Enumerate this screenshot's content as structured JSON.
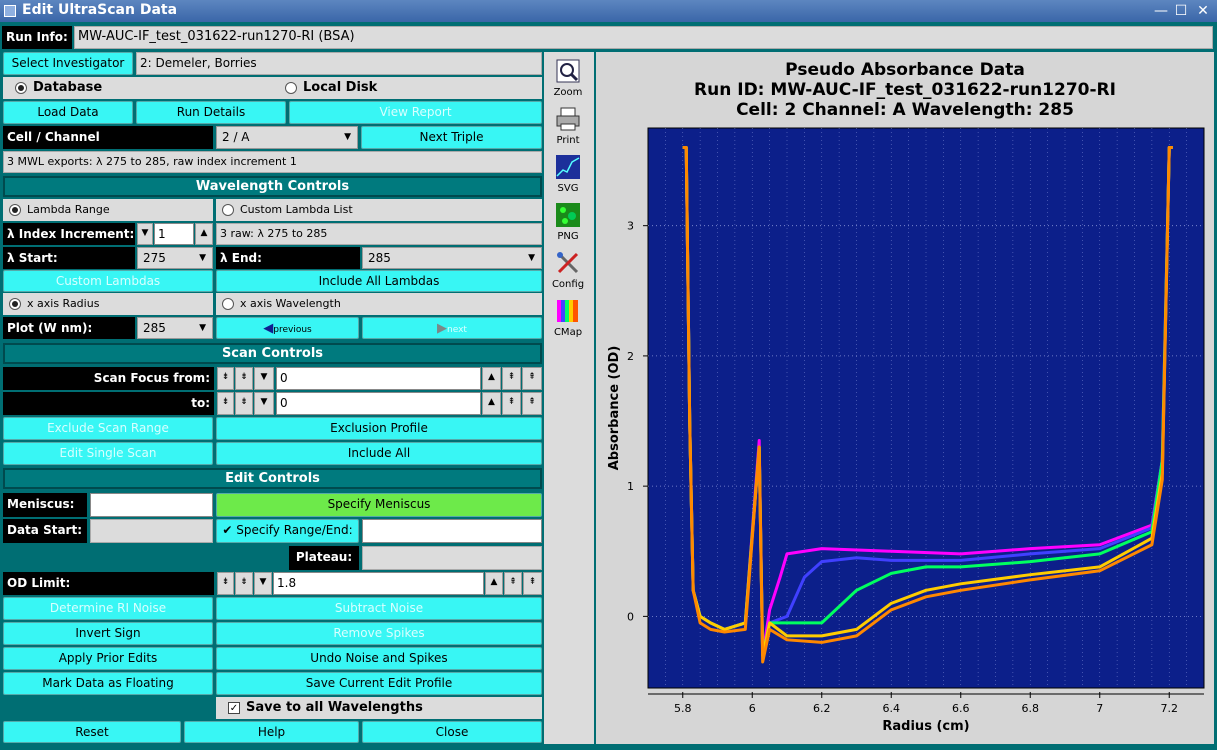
{
  "window": {
    "title": "Edit UltraScan Data",
    "controls": [
      "—",
      "☐",
      "✕"
    ]
  },
  "run_info": {
    "label": "Run Info:",
    "value": "MW-AUC-IF_test_031622-run1270-RI  (BSA)"
  },
  "investigator": {
    "button": "Select Investigator",
    "value": "2: Demeler, Borries"
  },
  "source": {
    "database": "Database",
    "local": "Local Disk"
  },
  "top_buttons": {
    "load": "Load Data",
    "details": "Run Details",
    "report": "View Report"
  },
  "cell_channel": {
    "label": "Cell / Channel",
    "value": "2 / A",
    "next": "Next Triple"
  },
  "mwl_info": "3 MWL exports: λ 275 to 285, raw index increment 1",
  "wavelength": {
    "header": "Wavelength Controls",
    "lambda_range": "Lambda Range",
    "custom_list": "Custom Lambda List",
    "index_label": "λ Index Increment:",
    "index_value": "1",
    "raw_info": "3 raw: λ 275 to 285",
    "start_label": "λ Start:",
    "start_value": "275",
    "end_label": "λ End:",
    "end_value": "285",
    "custom_lambdas": "Custom Lambdas",
    "include_all": "Include All Lambdas",
    "x_radius": "x axis Radius",
    "x_wavelength": "x axis Wavelength",
    "plot_label": "Plot (W nm):",
    "plot_value": "285",
    "previous": "previous",
    "next": "next"
  },
  "scan": {
    "header": "Scan Controls",
    "focus_from": "Scan Focus from:",
    "from_value": "0",
    "to": "to:",
    "to_value": "0",
    "exclude": "Exclude Scan Range",
    "profile": "Exclusion Profile",
    "edit_single": "Edit Single Scan",
    "include_all": "Include All"
  },
  "edit": {
    "header": "Edit Controls",
    "meniscus": "Meniscus:",
    "specify_meniscus": "Specify Meniscus",
    "data_start": "Data Start:",
    "specify_range": "Specify Range/End:",
    "plateau": "Plateau:",
    "od_limit": "OD Limit:",
    "od_value": "1.8",
    "ri_noise": "Determine RI Noise",
    "subtract": "Subtract Noise",
    "invert": "Invert Sign",
    "remove_spikes": "Remove Spikes",
    "apply_prior": "Apply Prior Edits",
    "undo": "Undo Noise and Spikes",
    "floating": "Mark Data as Floating",
    "save_profile": "Save Current Edit Profile",
    "save_all": "Save to all Wavelengths"
  },
  "bottom": {
    "reset": "Reset",
    "help": "Help",
    "close": "Close"
  },
  "tools": [
    "Zoom",
    "Print",
    "SVG",
    "PNG",
    "Config",
    "CMap"
  ],
  "chart_data": {
    "type": "line",
    "title": "Pseudo Absorbance Data",
    "subtitle1": "Run ID: MW-AUC-IF_test_031622-run1270-RI",
    "subtitle2": "Cell: 2  Channel: A  Wavelength: 285",
    "xlabel": "Radius (cm)",
    "ylabel": "Absorbance (OD)",
    "xlim": [
      5.7,
      7.3
    ],
    "ylim": [
      -0.55,
      3.75
    ],
    "x_ticks": [
      "5.8",
      "6",
      "6.2",
      "6.4",
      "6.6",
      "6.8",
      "7",
      "7.2"
    ],
    "x_tick_values": [
      5.8,
      6.0,
      6.2,
      6.4,
      6.6,
      6.8,
      7.0,
      7.2
    ],
    "y_ticks": [
      "0",
      "1",
      "2",
      "3"
    ],
    "y_tick_values": [
      0,
      1,
      2,
      3
    ],
    "background": "#0c1f8a",
    "series": [
      {
        "color": "#ff00ff",
        "x": [
          5.8,
          5.81,
          5.82,
          5.83,
          5.85,
          5.88,
          5.92,
          5.98,
          6.02,
          6.03,
          6.05,
          6.08,
          6.1,
          6.15,
          6.2,
          6.4,
          6.6,
          6.8,
          7.0,
          7.15,
          7.18,
          7.2,
          7.21
        ],
        "y": [
          3.6,
          3.6,
          1.5,
          0.2,
          0.0,
          -0.05,
          -0.1,
          -0.05,
          1.35,
          -0.3,
          0.05,
          0.3,
          0.48,
          0.5,
          0.52,
          0.5,
          0.48,
          0.52,
          0.55,
          0.7,
          1.2,
          3.6,
          3.6
        ]
      },
      {
        "color": "#4040ff",
        "x": [
          5.8,
          5.81,
          5.82,
          5.83,
          5.85,
          5.88,
          5.92,
          5.98,
          6.02,
          6.03,
          6.05,
          6.1,
          6.15,
          6.2,
          6.3,
          6.4,
          6.6,
          6.8,
          7.0,
          7.15,
          7.18,
          7.2,
          7.21
        ],
        "y": [
          3.6,
          3.6,
          1.5,
          0.2,
          0.0,
          -0.05,
          -0.1,
          -0.05,
          1.3,
          -0.3,
          -0.05,
          0.0,
          0.3,
          0.42,
          0.45,
          0.43,
          0.43,
          0.48,
          0.52,
          0.68,
          1.2,
          3.6,
          3.6
        ]
      },
      {
        "color": "#00ff60",
        "x": [
          5.8,
          5.81,
          5.82,
          5.83,
          5.85,
          5.88,
          5.92,
          5.98,
          6.02,
          6.03,
          6.05,
          6.1,
          6.2,
          6.3,
          6.4,
          6.5,
          6.6,
          6.8,
          7.0,
          7.15,
          7.18,
          7.2,
          7.21
        ],
        "y": [
          3.6,
          3.6,
          1.5,
          0.2,
          0.0,
          -0.05,
          -0.1,
          -0.05,
          1.3,
          -0.3,
          -0.05,
          -0.05,
          -0.05,
          0.2,
          0.33,
          0.38,
          0.38,
          0.42,
          0.48,
          0.65,
          1.2,
          3.6,
          3.6
        ]
      },
      {
        "color": "#ffcc00",
        "x": [
          5.8,
          5.81,
          5.82,
          5.83,
          5.85,
          5.88,
          5.92,
          5.98,
          6.02,
          6.03,
          6.05,
          6.1,
          6.2,
          6.3,
          6.4,
          6.5,
          6.6,
          6.8,
          7.0,
          7.15,
          7.18,
          7.2,
          7.21
        ],
        "y": [
          3.6,
          3.6,
          1.5,
          0.2,
          0.0,
          -0.05,
          -0.1,
          -0.05,
          1.3,
          -0.3,
          -0.05,
          -0.15,
          -0.15,
          -0.1,
          0.1,
          0.2,
          0.25,
          0.32,
          0.38,
          0.6,
          1.1,
          3.6,
          3.6
        ]
      },
      {
        "color": "#ff8800",
        "x": [
          5.8,
          5.81,
          5.82,
          5.83,
          5.85,
          5.88,
          5.92,
          5.98,
          6.02,
          6.03,
          6.05,
          6.1,
          6.2,
          6.3,
          6.4,
          6.5,
          6.6,
          6.8,
          7.0,
          7.15,
          7.18,
          7.2,
          7.21
        ],
        "y": [
          3.6,
          3.6,
          1.5,
          0.2,
          -0.05,
          -0.1,
          -0.12,
          -0.1,
          1.3,
          -0.35,
          -0.1,
          -0.18,
          -0.2,
          -0.15,
          0.05,
          0.15,
          0.2,
          0.28,
          0.35,
          0.55,
          1.05,
          3.6,
          3.6
        ]
      }
    ]
  }
}
